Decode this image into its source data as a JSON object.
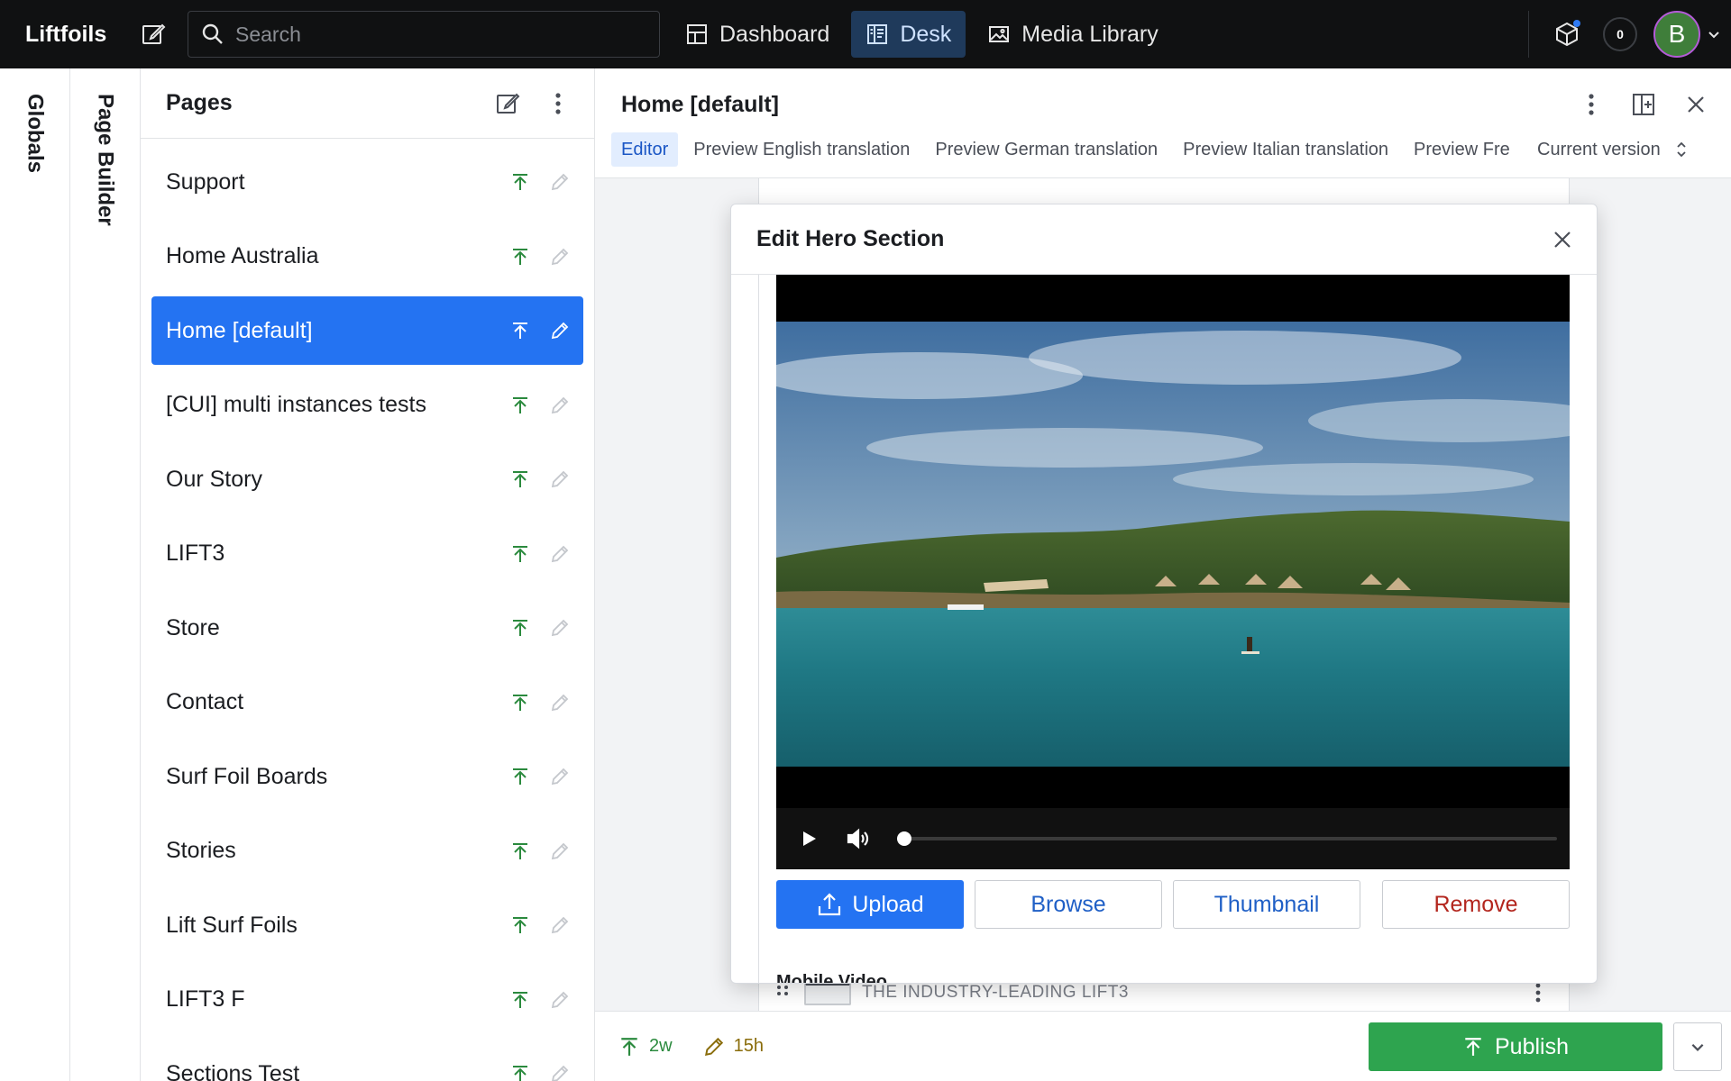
{
  "topbar": {
    "brand": "Liftfoils",
    "search_placeholder": "Search",
    "tabs": [
      {
        "label": "Dashboard",
        "icon": "dashboard-icon"
      },
      {
        "label": "Desk",
        "icon": "desk-icon",
        "active": true
      },
      {
        "label": "Media Library",
        "icon": "image-icon"
      }
    ],
    "notification_count": "0",
    "avatar_initial": "B"
  },
  "rails": {
    "first": "Globals",
    "second": "Page Builder"
  },
  "pages": {
    "title": "Pages",
    "items": [
      {
        "label": "Support"
      },
      {
        "label": "Home Australia"
      },
      {
        "label": "Home [default]",
        "selected": true
      },
      {
        "label": "[CUI] multi instances tests"
      },
      {
        "label": "Our Story"
      },
      {
        "label": "LIFT3"
      },
      {
        "label": "Store"
      },
      {
        "label": "Contact"
      },
      {
        "label": "Surf Foil Boards"
      },
      {
        "label": "Stories"
      },
      {
        "label": "Lift Surf Foils"
      },
      {
        "label": "LIFT3 F"
      },
      {
        "label": "Sections Test"
      }
    ]
  },
  "document": {
    "title": "Home [default]",
    "tabs": [
      "Editor",
      "Preview English translation",
      "Preview German translation",
      "Preview Italian translation",
      "Preview Fre"
    ],
    "active_tab": "Editor",
    "version": "Current version"
  },
  "modal": {
    "title": "Edit Hero Section",
    "video": {
      "progress": 0
    },
    "buttons": {
      "upload": "Upload",
      "browse": "Browse",
      "thumbnail": "Thumbnail",
      "remove": "Remove"
    },
    "next_field_label": "Mobile Video"
  },
  "behind": {
    "row_text": "THE INDUSTRY-LEADING LIFT3"
  },
  "footer": {
    "published_ago": "2w",
    "edited_ago": "15h",
    "publish_label": "Publish"
  },
  "colors": {
    "accent": "#2473f2",
    "publish": "#2ea44f",
    "topbar": "#101112",
    "remove": "#b3261e"
  }
}
